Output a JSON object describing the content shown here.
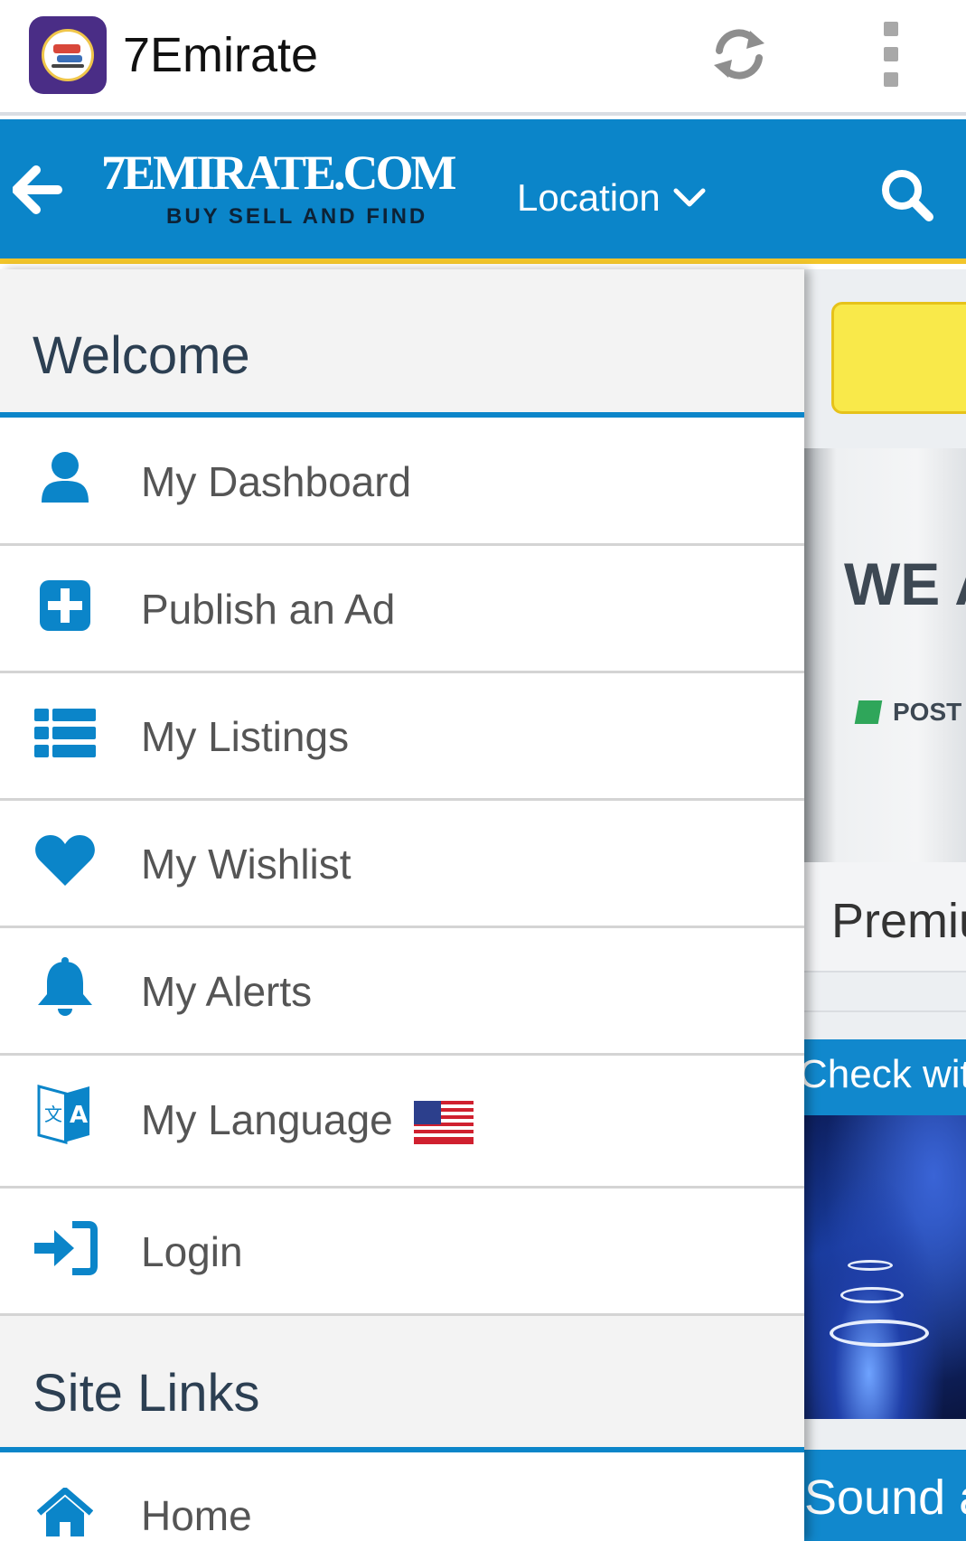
{
  "app_bar": {
    "title": "7Emirate",
    "refresh_icon": "refresh-icon",
    "more_icon": "more-vertical-icon"
  },
  "header": {
    "logo_main": "7EMIRATE.COM",
    "logo_tagline": "BUY SELL AND FIND",
    "location_label": "Location",
    "back_icon": "arrow-left-icon",
    "search_icon": "search-icon",
    "colors": {
      "bar": "#0b85c9",
      "accent": "#f2c52a"
    }
  },
  "drawer": {
    "welcome_heading": "Welcome",
    "items": [
      {
        "label": "My Dashboard",
        "icon": "user-icon"
      },
      {
        "label": "Publish an Ad",
        "icon": "plus-square-icon"
      },
      {
        "label": "My Listings",
        "icon": "list-icon"
      },
      {
        "label": "My Wishlist",
        "icon": "heart-icon"
      },
      {
        "label": "My Alerts",
        "icon": "bell-icon"
      },
      {
        "label": "My Language",
        "icon": "translate-icon",
        "flag": "us-flag-icon"
      },
      {
        "label": "Login",
        "icon": "sign-in-icon"
      }
    ],
    "site_links_heading": "Site Links",
    "site_links": [
      {
        "label": "Home",
        "icon": "home-icon"
      }
    ],
    "icon_color": "#0b85c9"
  },
  "background_page": {
    "banner_title": "WE A",
    "banner_post": "POST",
    "premium_label": "Premiu",
    "check_label": "Check with",
    "sound_label": "Sound a"
  }
}
